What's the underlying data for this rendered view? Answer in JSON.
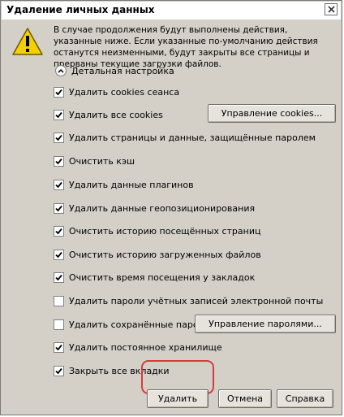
{
  "window": {
    "title": "Удаление личных данных",
    "close_icon": "close-icon"
  },
  "description": "В случае продолжения будут выполнены действия, указанные ниже. Если указанные по-умолчанию действия останутся неизменными, будут закрыты все страницы и прерваны текущие загрузки файлов.",
  "detail_toggle": {
    "label": "Детальная настройка",
    "icon": "chevron-up-icon"
  },
  "options": [
    {
      "label": "Удалить cookies сеанса",
      "checked": true
    },
    {
      "label": "Удалить все cookies",
      "checked": true
    },
    {
      "label": "Удалить страницы и данные, защищённые паролем",
      "checked": true
    },
    {
      "label": "Очистить кэш",
      "checked": true
    },
    {
      "label": "Удалить данные плагинов",
      "checked": true
    },
    {
      "label": "Удалить данные геопозиционирования",
      "checked": true
    },
    {
      "label": "Очистить историю посещённых страниц",
      "checked": true
    },
    {
      "label": "Очистить историю загруженных файлов",
      "checked": true
    },
    {
      "label": "Очистить время посещения у закладок",
      "checked": true
    },
    {
      "label": "Удалить пароли учётных записей электронной почты",
      "checked": false
    },
    {
      "label": "Удалить сохранённые пароли",
      "checked": false
    },
    {
      "label": "Удалить постоянное хранилище",
      "checked": true
    },
    {
      "label": "Закрыть все вкладки",
      "checked": true
    }
  ],
  "buttons": {
    "manage_cookies": "Управление cookies...",
    "manage_passwords": "Управление паролями...",
    "delete": "Удалить",
    "cancel": "Отмена",
    "help": "Справка"
  },
  "colors": {
    "dialog_bg": "#d4d0c8",
    "highlight": "#d43c3c",
    "warning": "#f5d000"
  }
}
